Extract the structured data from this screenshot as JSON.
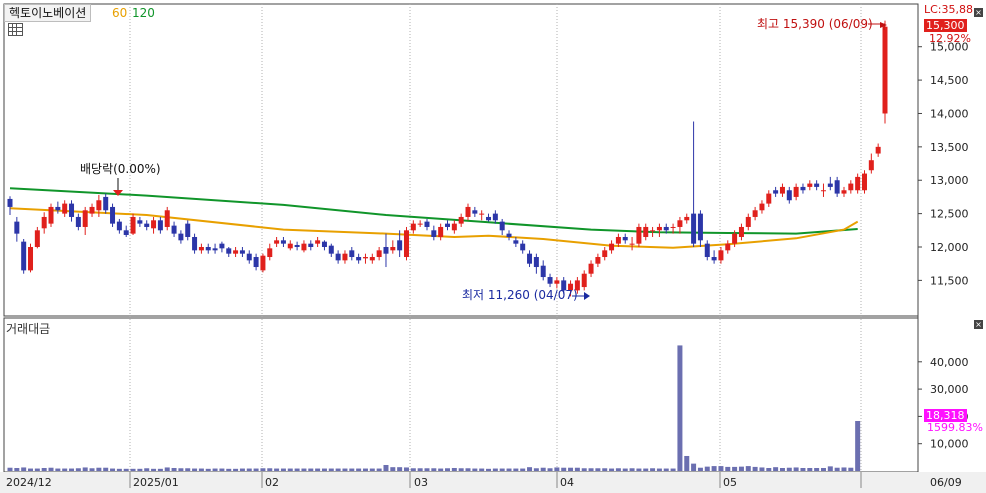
{
  "stock": {
    "name": "헥토이노베이션"
  },
  "moving_averages": [
    {
      "period": "60",
      "color": "#e8a000"
    },
    {
      "period": "120",
      "color": "#10952a"
    }
  ],
  "last_close_label": "LC:35,88",
  "price_box": {
    "value": "15,300",
    "change": "12.92%"
  },
  "volume_box": {
    "value": "18,318",
    "change": "1599.83%"
  },
  "subchart_title": "거래대금",
  "annotations": {
    "dividend": "배당락(0.00%)",
    "high": "최고 15,390 (06/09)",
    "low": "최저 11,260 (04/07)"
  },
  "date_labels": [
    "2024/12",
    "2025/01",
    "02",
    "03",
    "04",
    "05",
    "06/09"
  ],
  "chart_data": {
    "type": "candlestick",
    "price_axis": {
      "ticks": [
        11500,
        12000,
        12500,
        13000,
        13500,
        14000,
        14500,
        15000
      ],
      "labels": [
        "11,500",
        "12,000",
        "12,500",
        "13,000",
        "13,500",
        "14,000",
        "14,500",
        "15,000"
      ]
    },
    "volume_axis": {
      "ticks": [
        10000,
        20000,
        30000,
        40000
      ],
      "labels": [
        "10,000",
        "20,000",
        "30,000",
        "40,000"
      ]
    },
    "colors": {
      "up": "#e0201c",
      "down": "#2c36a8",
      "volume": "#6b6fb0"
    },
    "candles": [
      [
        12720,
        12600,
        12480,
        12760
      ],
      [
        12380,
        12200,
        12080,
        12450
      ],
      [
        12080,
        11650,
        11600,
        12120
      ],
      [
        11650,
        12000,
        11620,
        12050
      ],
      [
        12000,
        12250,
        11980,
        12300
      ],
      [
        12280,
        12450,
        12200,
        12520
      ],
      [
        12350,
        12600,
        12300,
        12650
      ],
      [
        12600,
        12550,
        12500,
        12680
      ],
      [
        12500,
        12650,
        12450,
        12700
      ],
      [
        12650,
        12450,
        12380,
        12700
      ],
      [
        12450,
        12300,
        12250,
        12500
      ],
      [
        12300,
        12550,
        12180,
        12600
      ],
      [
        12500,
        12600,
        12450,
        12650
      ],
      [
        12550,
        12700,
        12450,
        12780
      ],
      [
        12750,
        12550,
        12500,
        12800
      ],
      [
        12600,
        12350,
        12300,
        12650
      ],
      [
        12380,
        12250,
        12200,
        12420
      ],
      [
        12250,
        12180,
        12150,
        12320
      ],
      [
        12200,
        12450,
        12180,
        12500
      ],
      [
        12400,
        12350,
        12300,
        12450
      ],
      [
        12350,
        12300,
        12250,
        12400
      ],
      [
        12280,
        12400,
        12200,
        12450
      ],
      [
        12400,
        12250,
        12200,
        12450
      ],
      [
        12300,
        12550,
        12250,
        12600
      ],
      [
        12320,
        12200,
        12150,
        12380
      ],
      [
        12200,
        12100,
        12050,
        12250
      ],
      [
        12350,
        12150,
        12100,
        12400
      ],
      [
        12150,
        11950,
        11900,
        12200
      ],
      [
        11950,
        12000,
        11900,
        12050
      ],
      [
        12000,
        11950,
        11900,
        12050
      ],
      [
        11980,
        11950,
        11900,
        12050
      ],
      [
        12050,
        11980,
        11920,
        12080
      ],
      [
        11980,
        11900,
        11850,
        12000
      ],
      [
        11900,
        11950,
        11850,
        12000
      ],
      [
        11950,
        11900,
        11850,
        12000
      ],
      [
        11900,
        11800,
        11750,
        11950
      ],
      [
        11850,
        11700,
        11650,
        11900
      ],
      [
        11650,
        11870,
        11620,
        11900
      ],
      [
        11850,
        11980,
        11800,
        12050
      ],
      [
        12050,
        12100,
        12000,
        12150
      ],
      [
        12100,
        12050,
        12000,
        12150
      ],
      [
        11980,
        12050,
        11950,
        12100
      ],
      [
        12030,
        12000,
        11950,
        12080
      ],
      [
        11950,
        12050,
        11920,
        12100
      ],
      [
        12050,
        12000,
        11950,
        12100
      ],
      [
        12050,
        12100,
        12000,
        12150
      ],
      [
        12080,
        12000,
        11950,
        12100
      ],
      [
        12020,
        11900,
        11850,
        12050
      ],
      [
        11900,
        11800,
        11750,
        11950
      ],
      [
        11800,
        11900,
        11750,
        11950
      ],
      [
        11950,
        11850,
        11800,
        12000
      ],
      [
        11850,
        11800,
        11750,
        11900
      ],
      [
        11830,
        11850,
        11750,
        11900
      ],
      [
        11800,
        11850,
        11750,
        11900
      ],
      [
        11850,
        11950,
        11800,
        12000
      ],
      [
        12000,
        11900,
        11700,
        12200
      ],
      [
        11950,
        12000,
        11900,
        12100
      ],
      [
        12100,
        11950,
        11850,
        12250
      ],
      [
        11850,
        12250,
        11800,
        12300
      ],
      [
        12250,
        12350,
        12200,
        12400
      ],
      [
        12350,
        12350,
        12300,
        12400
      ],
      [
        12380,
        12300,
        12250,
        12420
      ],
      [
        12250,
        12150,
        12100,
        12320
      ],
      [
        12150,
        12300,
        12100,
        12350
      ],
      [
        12350,
        12300,
        12250,
        12400
      ],
      [
        12250,
        12350,
        12200,
        12400
      ],
      [
        12350,
        12450,
        12300,
        12500
      ],
      [
        12450,
        12600,
        12400,
        12650
      ],
      [
        12550,
        12500,
        12450,
        12600
      ],
      [
        12500,
        12500,
        12400,
        12550
      ],
      [
        12450,
        12400,
        12380,
        12500
      ],
      [
        12500,
        12400,
        12350,
        12550
      ],
      [
        12380,
        12250,
        12180,
        12420
      ],
      [
        12200,
        12150,
        12100,
        12250
      ],
      [
        12100,
        12050,
        12000,
        12150
      ],
      [
        12050,
        11950,
        11900,
        12100
      ],
      [
        11900,
        11750,
        11700,
        11950
      ],
      [
        11850,
        11700,
        11600,
        11900
      ],
      [
        11720,
        11550,
        11500,
        11800
      ],
      [
        11550,
        11450,
        11400,
        11600
      ],
      [
        11450,
        11500,
        11380,
        11550
      ],
      [
        11500,
        11350,
        11300,
        11550
      ],
      [
        11350,
        11450,
        11260,
        11500
      ],
      [
        11350,
        11500,
        11300,
        11550
      ],
      [
        11400,
        11600,
        11350,
        11650
      ],
      [
        11600,
        11750,
        11550,
        11800
      ],
      [
        11750,
        11850,
        11700,
        11900
      ],
      [
        11850,
        11950,
        11800,
        12000
      ],
      [
        11950,
        12050,
        11900,
        12100
      ],
      [
        12050,
        12150,
        12000,
        12200
      ],
      [
        12150,
        12100,
        12050,
        12200
      ],
      [
        12050,
        12050,
        11950,
        12150
      ],
      [
        12050,
        12300,
        12000,
        12350
      ],
      [
        12150,
        12300,
        12100,
        12350
      ],
      [
        12250,
        12250,
        12150,
        12300
      ],
      [
        12250,
        12300,
        12150,
        12350
      ],
      [
        12300,
        12250,
        12200,
        12350
      ],
      [
        12300,
        12300,
        12200,
        12350
      ],
      [
        12300,
        12400,
        12200,
        12450
      ],
      [
        12400,
        12450,
        12350,
        12500
      ],
      [
        12500,
        12050,
        12000,
        13880
      ],
      [
        12500,
        12100,
        12000,
        12550
      ],
      [
        12050,
        11850,
        11800,
        12100
      ],
      [
        11850,
        11800,
        11750,
        11950
      ],
      [
        11800,
        11950,
        11750,
        12000
      ],
      [
        11950,
        12050,
        11900,
        12100
      ],
      [
        12050,
        12200,
        12000,
        12250
      ],
      [
        12150,
        12300,
        12100,
        12350
      ],
      [
        12300,
        12450,
        12250,
        12500
      ],
      [
        12450,
        12550,
        12400,
        12600
      ],
      [
        12550,
        12650,
        12500,
        12700
      ],
      [
        12650,
        12800,
        12600,
        12850
      ],
      [
        12850,
        12800,
        12750,
        12900
      ],
      [
        12800,
        12900,
        12750,
        12950
      ],
      [
        12850,
        12700,
        12650,
        12900
      ],
      [
        12750,
        12900,
        12700,
        12950
      ],
      [
        12900,
        12850,
        12800,
        12950
      ],
      [
        12900,
        12950,
        12850,
        13000
      ],
      [
        12950,
        12900,
        12850,
        13000
      ],
      [
        12850,
        12850,
        12750,
        12950
      ],
      [
        12950,
        12900,
        12850,
        13050
      ],
      [
        13000,
        12800,
        12750,
        13050
      ],
      [
        12800,
        12850,
        12750,
        12900
      ],
      [
        12850,
        12950,
        12800,
        13000
      ],
      [
        12850,
        13050,
        12800,
        13100
      ],
      [
        12850,
        13100,
        12800,
        13150
      ],
      [
        13150,
        13300,
        13100,
        13400
      ],
      [
        13400,
        13500,
        13350,
        13550
      ],
      [
        14000,
        15300,
        13850,
        15390
      ]
    ],
    "volume": [
      1200,
      1100,
      1300,
      900,
      900,
      1100,
      1200,
      900,
      900,
      900,
      1000,
      1300,
      1000,
      1200,
      1200,
      900,
      800,
      800,
      800,
      800,
      1000,
      800,
      800,
      1300,
      1100,
      1000,
      1000,
      900,
      900,
      800,
      900,
      900,
      800,
      800,
      900,
      900,
      900,
      1000,
      1000,
      900,
      900,
      900,
      900,
      900,
      900,
      900,
      900,
      900,
      900,
      900,
      900,
      900,
      900,
      900,
      900,
      2200,
      1400,
      1400,
      1300,
      1000,
      1000,
      1000,
      1000,
      900,
      1000,
      1100,
      1000,
      1000,
      900,
      900,
      800,
      900,
      900,
      900,
      900,
      900,
      1400,
      1000,
      1200,
      1000,
      1300,
      1200,
      1200,
      1200,
      1000,
      1000,
      1000,
      1000,
      900,
      1000,
      900,
      1000,
      900,
      900,
      1000,
      900,
      900,
      900,
      46000,
      5500,
      2700,
      1200,
      1600,
      1800,
      1800,
      1500,
      1500,
      1600,
      1800,
      1500,
      1300,
      1100,
      1400,
      1100,
      1200,
      1300,
      1100,
      1100,
      1100,
      1100,
      1700,
      1200,
      1300,
      1200,
      18318
    ],
    "ma60": [
      [
        0,
        12580
      ],
      [
        20,
        12480
      ],
      [
        40,
        12260
      ],
      [
        55,
        12200
      ],
      [
        65,
        12150
      ],
      [
        70,
        12170
      ],
      [
        78,
        12120
      ],
      [
        88,
        12020
      ],
      [
        97,
        11990
      ],
      [
        105,
        12040
      ],
      [
        115,
        12130
      ],
      [
        122,
        12260
      ],
      [
        124,
        12380
      ]
    ],
    "ma120": [
      [
        0,
        12880
      ],
      [
        20,
        12770
      ],
      [
        40,
        12630
      ],
      [
        55,
        12480
      ],
      [
        70,
        12370
      ],
      [
        85,
        12260
      ],
      [
        95,
        12220
      ],
      [
        105,
        12210
      ],
      [
        115,
        12200
      ],
      [
        124,
        12270
      ]
    ]
  }
}
